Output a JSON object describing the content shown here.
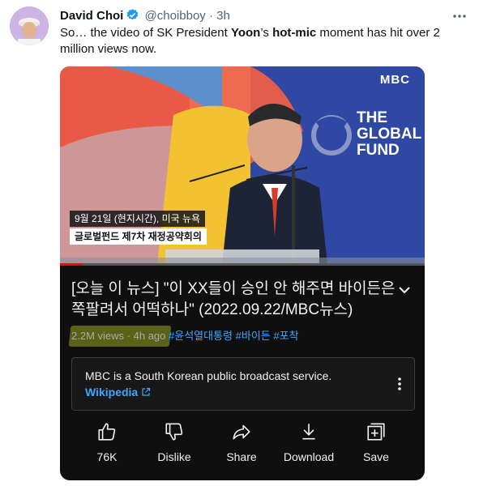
{
  "tweet": {
    "author_name": "David Choi",
    "handle": "@choibboy",
    "separator": "·",
    "time": "3h",
    "more_icon": "more-horizontal-icon",
    "text_before": "So… the video of SK President ",
    "text_bold_1": "Yoon",
    "text_mid": "’s ",
    "text_bold_2": "hot-mic",
    "text_after": " moment has hit over 2 million views now."
  },
  "video": {
    "logo": "MBC",
    "banner_line1": "THE",
    "banner_line2": "GLOBAL",
    "banner_line3": "FUND",
    "caption_line1": "9월 21일 (현지시간), 미국 뉴욕",
    "caption_line2": "글로벌펀드 제7차 재정공약회의",
    "title": "[오늘 이 뉴스] \"이 XX들이 승인 안 해주면 바이든은 쪽팔려서 어떡하나\" (2022.09.22/MBC뉴스)",
    "views": "2.2M views",
    "age": "4h ago",
    "tags": [
      "#윤석열대통령",
      "#바이든",
      "#포착"
    ],
    "progress_fraction": 0.06
  },
  "info_panel": {
    "text": "MBC is a South Korean public broadcast service.",
    "link": "Wikipedia"
  },
  "actions": [
    {
      "label": "76K",
      "icon": "thumbs-up-icon"
    },
    {
      "label": "Dislike",
      "icon": "thumbs-down-icon"
    },
    {
      "label": "Share",
      "icon": "share-icon"
    },
    {
      "label": "Download",
      "icon": "download-icon"
    },
    {
      "label": "Save",
      "icon": "save-playlist-icon"
    }
  ],
  "colors": {
    "tweet_text": "#0f1419",
    "muted": "#536471",
    "verified": "#1d9bf0",
    "yt_link": "#3ea6ff",
    "card_bg": "#0f0f0f",
    "progress": "#ff0000"
  }
}
